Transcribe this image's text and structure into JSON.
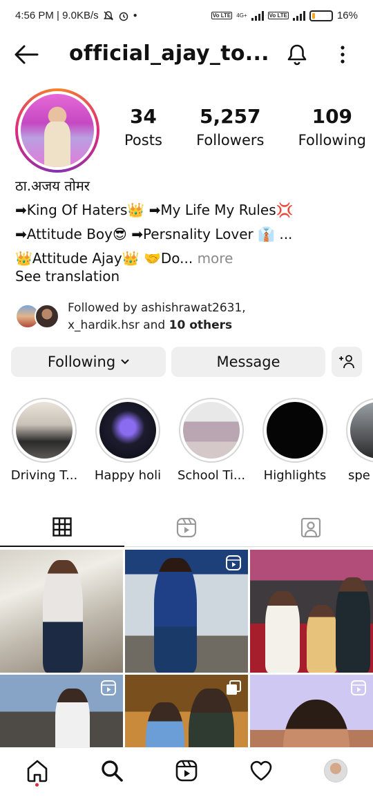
{
  "status_bar": {
    "time_net": "4:56 PM | 9.0KB/s",
    "net_gen": "4G+",
    "volte": "Vo LTE",
    "battery_pct": "16%",
    "battery_level": 0.16
  },
  "header": {
    "username": "official_ajay_to..."
  },
  "stats": {
    "posts": {
      "count": "34",
      "label": "Posts"
    },
    "followers": {
      "count": "5,257",
      "label": "Followers"
    },
    "following": {
      "count": "109",
      "label": "Following"
    }
  },
  "bio": {
    "name": "ठा.अजय तोमर",
    "line1": "➡King Of Haters👑 ➡My Life My Rules💢",
    "line2": "➡Attitude Boy😎 ➡Persnality Lover 👔 ...",
    "line3": "👑Attitude Ajay👑 🤝Do...",
    "more": "more",
    "see_translation": "See translation"
  },
  "followed_by": {
    "prefix": "Followed by ashishrawat2631,",
    "line2_start": "x_hardik.hsr and ",
    "others": "10 others"
  },
  "buttons": {
    "following": "Following",
    "message": "Message"
  },
  "highlights": [
    {
      "label": "Driving T..."
    },
    {
      "label": "Happy holi"
    },
    {
      "label": "School Ti..."
    },
    {
      "label": "Highlights"
    },
    {
      "label": "spe"
    }
  ],
  "tabs": [
    {
      "icon": "grid-icon",
      "active": true
    },
    {
      "icon": "reels-icon",
      "active": false
    },
    {
      "icon": "tagged-icon",
      "active": false
    }
  ],
  "bottom_nav": [
    {
      "icon": "home-icon"
    },
    {
      "icon": "search-icon"
    },
    {
      "icon": "reels-icon"
    },
    {
      "icon": "heart-icon"
    },
    {
      "icon": "profile-avatar"
    }
  ],
  "colors": {
    "story_ring_start": "#f58529",
    "story_ring_end": "#dd2a7b",
    "button_bg": "#efefef",
    "notification_dot": "#e02a3a",
    "battery_low": "#f5a623"
  }
}
